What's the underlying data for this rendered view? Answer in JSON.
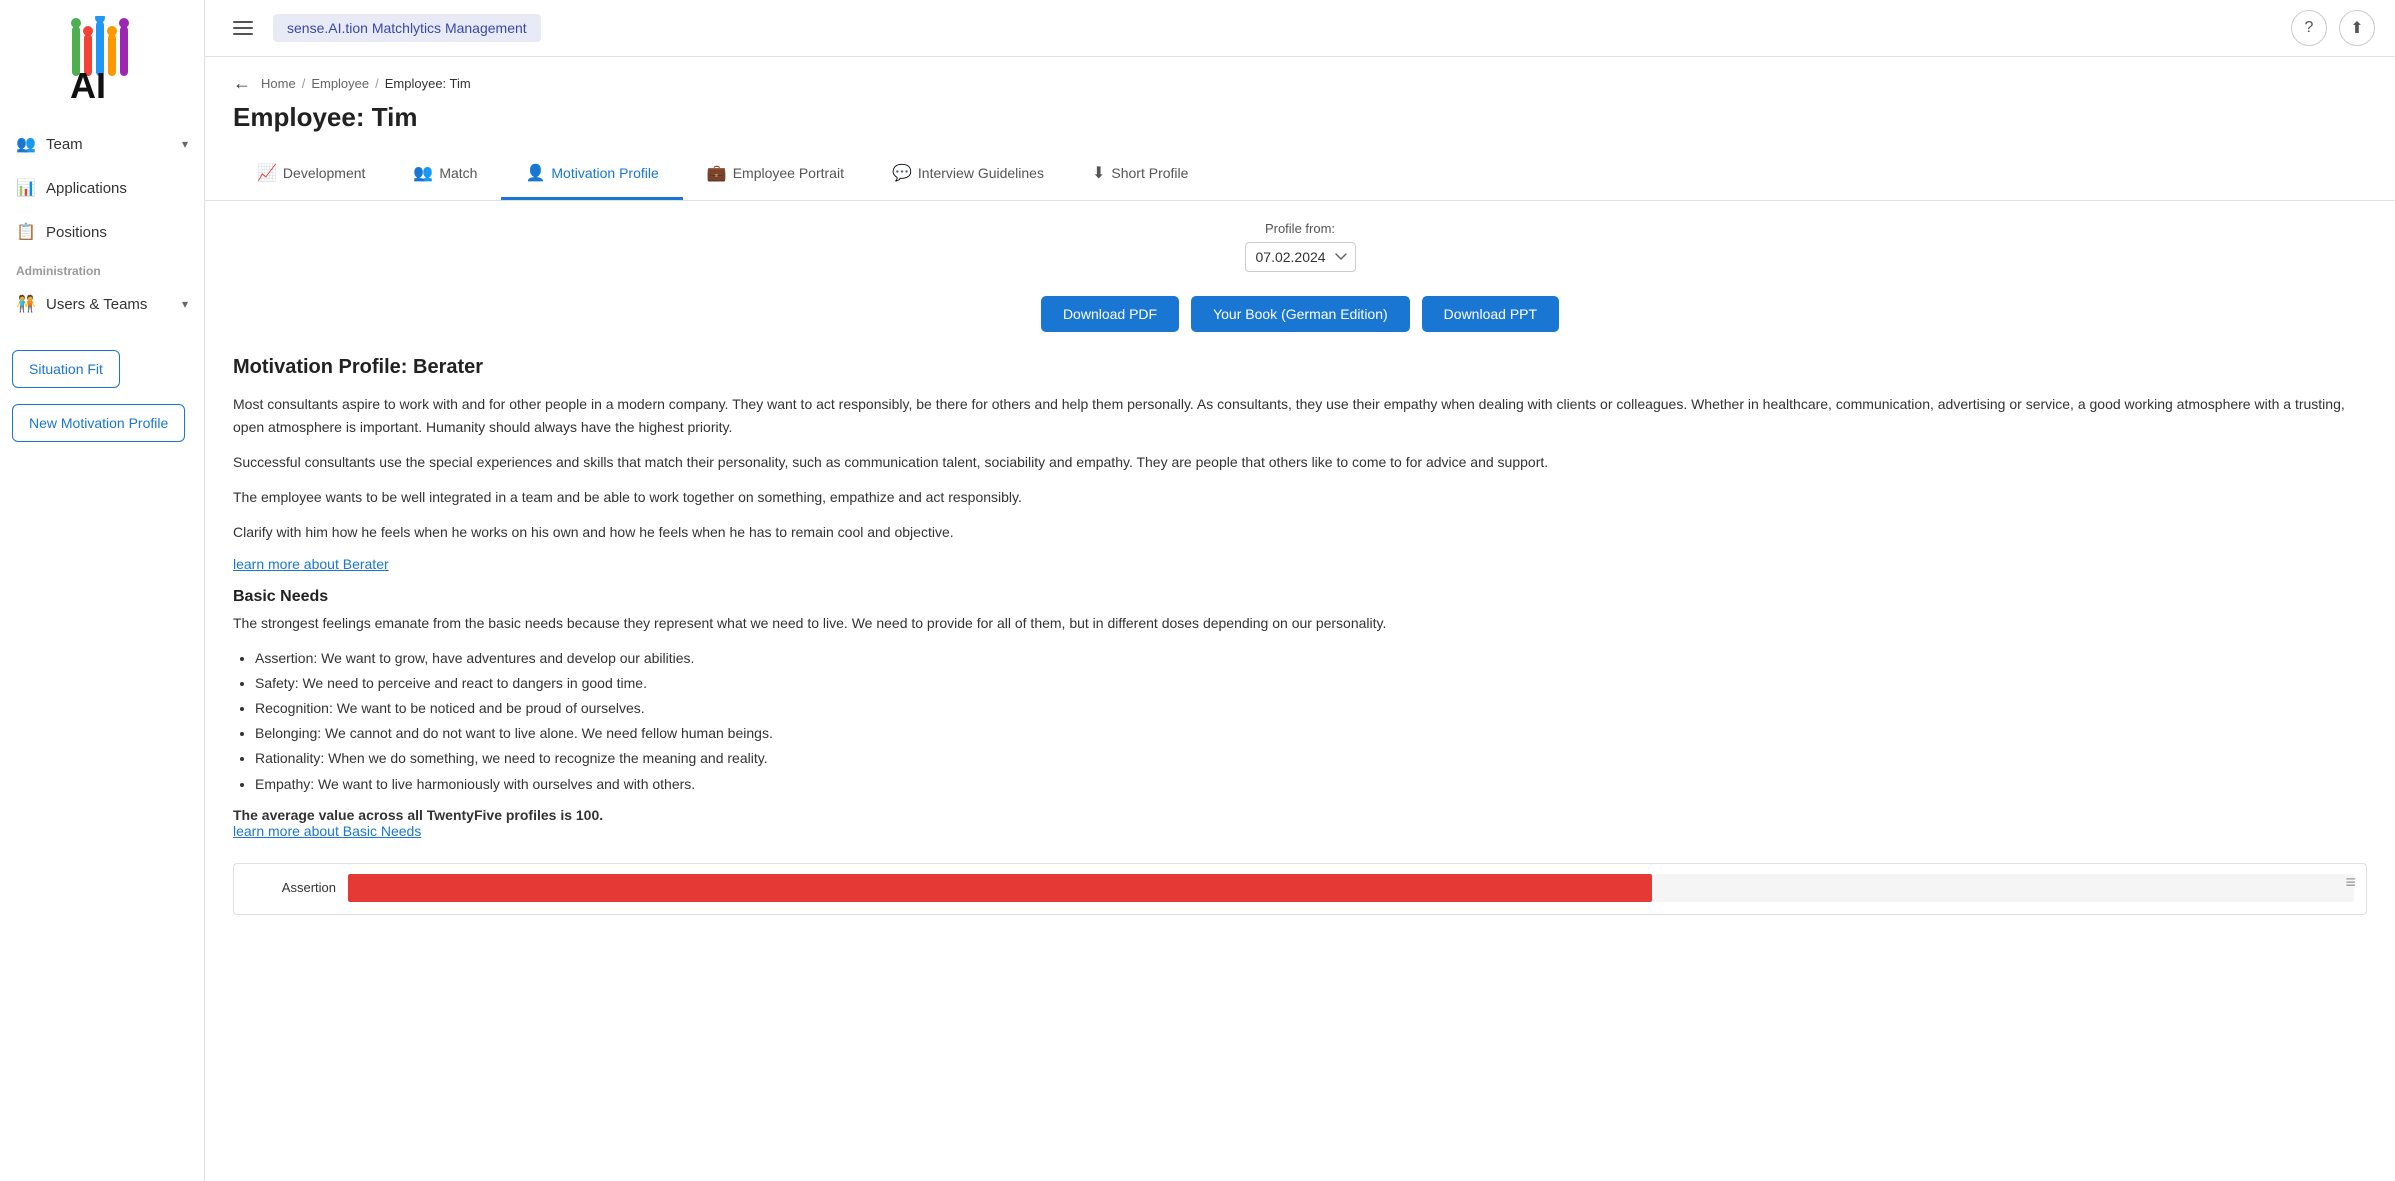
{
  "app": {
    "name": "sense.AI.tion Matchlytics Management"
  },
  "sidebar": {
    "nav_items": [
      {
        "id": "team",
        "label": "Team",
        "icon": "👥",
        "has_chevron": true
      },
      {
        "id": "applications",
        "label": "Applications",
        "icon": "📊",
        "has_chevron": false
      },
      {
        "id": "positions",
        "label": "Positions",
        "icon": "📋",
        "has_chevron": false
      }
    ],
    "admin_section_label": "Administration",
    "admin_items": [
      {
        "id": "users-teams",
        "label": "Users & Teams",
        "icon": "🧑‍🤝‍🧑",
        "has_chevron": true
      }
    ],
    "buttons": [
      {
        "id": "situation-fit",
        "label": "Situation Fit",
        "type": "outline"
      },
      {
        "id": "new-motivation-profile",
        "label": "New Motivation Profile",
        "type": "outline"
      }
    ]
  },
  "topbar": {
    "help_icon": "?",
    "export_icon": "⬆"
  },
  "breadcrumb": {
    "back_arrow": "←",
    "home": "Home",
    "employee": "Employee",
    "current": "Employee: Tim"
  },
  "page": {
    "title": "Employee: Tim"
  },
  "tabs": [
    {
      "id": "development",
      "label": "Development",
      "icon": "📈",
      "active": false
    },
    {
      "id": "match",
      "label": "Match",
      "icon": "👥",
      "active": false
    },
    {
      "id": "motivation-profile",
      "label": "Motivation Profile",
      "icon": "👤",
      "active": true
    },
    {
      "id": "employee-portrait",
      "label": "Employee Portrait",
      "icon": "💼",
      "active": false
    },
    {
      "id": "interview-guidelines",
      "label": "Interview Guidelines",
      "icon": "💬",
      "active": false
    },
    {
      "id": "short-profile",
      "label": "Short Profile",
      "icon": "⬇",
      "active": false
    }
  ],
  "profile_from": {
    "label": "Profile from:",
    "value": "07.02.2024",
    "options": [
      "07.02.2024"
    ]
  },
  "action_buttons": [
    {
      "id": "download-pdf",
      "label": "Download PDF"
    },
    {
      "id": "your-book",
      "label": "Your Book (German Edition)"
    },
    {
      "id": "download-ppt",
      "label": "Download PPT"
    }
  ],
  "content": {
    "profile_heading": "Motivation Profile: Berater",
    "paragraphs": [
      "Most consultants aspire to work with and for other people in a modern company. They want to act responsibly, be there for others and help them personally. As consultants, they use their empathy when dealing with clients or colleagues. Whether in healthcare, communication, advertising or service, a good working atmosphere with a trusting, open atmosphere is important. Humanity should always have the highest priority.",
      "Successful consultants use the special experiences and skills that match their personality, such as communication talent, sociability and empathy. They are people that others like to come to for advice and support.",
      "The employee wants to be well integrated in a team and be able to work together on something, empathize and act responsibly.",
      "Clarify with him how he feels when he works on his own and how he feels when he has to remain cool and objective."
    ],
    "learn_more_berater_link": "learn more about Berater",
    "basic_needs": {
      "heading": "Basic Needs",
      "intro": "The strongest feelings emanate from the basic needs because they represent what we need to live. We need to provide for all of them, but in different doses depending on our personality.",
      "bullets": [
        "Assertion: We want to grow, have adventures and develop our abilities.",
        "Safety: We need to perceive and react to dangers in good time.",
        "Recognition: We want to be noticed and be proud of ourselves.",
        "Belonging: We cannot and do not want to live alone. We need fellow human beings.",
        "Rationality: When we do something, we need to recognize the meaning and reality.",
        "Empathy: We want to live harmoniously with ourselves and with others."
      ],
      "avg_text": "The average value across all TwentyFive profiles is 100.",
      "learn_more_link": "learn more about Basic Needs"
    },
    "chart": {
      "menu_icon": "≡",
      "rows": [
        {
          "label": "Assertion",
          "value": 65,
          "color": "#e53935"
        }
      ]
    }
  }
}
